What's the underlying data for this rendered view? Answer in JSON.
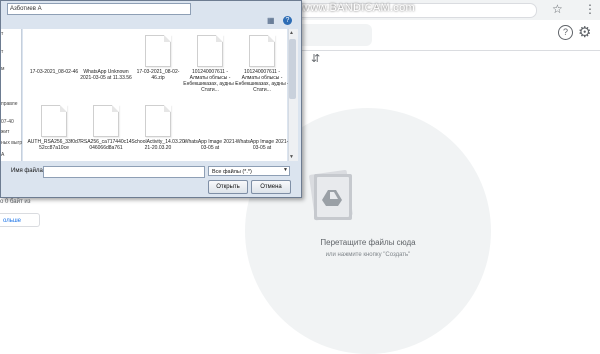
{
  "browser": {
    "watermark": "www.BANDICAM.com",
    "star_icon": "star-icon",
    "menu_icon": "kebab-menu-icon"
  },
  "drive": {
    "help_icon": "help-icon",
    "settings_icon": "gear-icon",
    "storage_text": "о 0 байт из",
    "more_storage_button": "ольше",
    "dropzone_title": "Перетащите файлы сюда",
    "dropzone_subtitle": "или нажмите кнопку \"Создать\""
  },
  "dialog": {
    "path_text": "Азботиев А",
    "nav_items": [
      "т",
      "т",
      "м",
      "правле",
      "07-40",
      "жит",
      "ных выгр",
      "А"
    ],
    "files": [
      {
        "name": "17-03-2021_08-02-46"
      },
      {
        "name": "WhatsApp Unknown 2021-03-05 at 11.33.56"
      },
      {
        "name": "17-03-2021_08-02-46.zip"
      },
      {
        "name": "101240007611 - Алматы облысы - Енбекшиказах, аудны - Стати..."
      },
      {
        "name": "101240007611 - Алматы облысы - Енбекшиказах, аудны - Стати..."
      },
      {
        "name": "AUTH_RSA256_33f0d752cc87a10ce"
      },
      {
        "name": "RSA256_ca717440c14046066d8a761"
      },
      {
        "name": "SchoolActivity_14.03.2021-20.03.20"
      },
      {
        "name": "WhatsApp Image 2021-03-05 at"
      },
      {
        "name": "WhatsApp Image 2021-03-05 at"
      }
    ],
    "filename_label": "Имя файла:",
    "filename_value": "",
    "filetype_value": "Все файлы (*.*)",
    "open_button": "Открыть",
    "cancel_button": "Отмена"
  }
}
